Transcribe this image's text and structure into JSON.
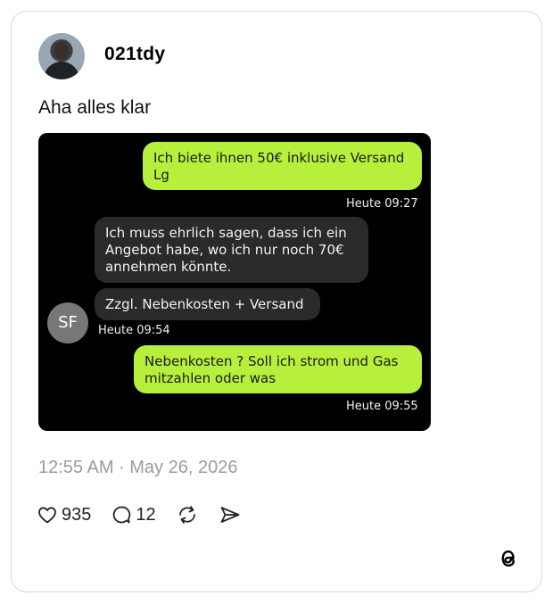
{
  "post": {
    "username": "021tdy",
    "text": "Aha alles klar",
    "timestamp": "12:55 AM · May 26, 2026"
  },
  "chat": {
    "messages": [
      {
        "direction": "out",
        "text": "Ich biete ihnen 50€ inklusive Versand Lg",
        "time": "Heute 09:27"
      },
      {
        "direction": "in",
        "text": "Ich muss ehrlich sagen, dass ich ein Angebot habe, wo ich nur noch 70€ annehmen könnte.",
        "time": ""
      },
      {
        "direction": "in",
        "text": "Zzgl. Nebenkosten + Versand",
        "time": "Heute 09:54"
      },
      {
        "direction": "out",
        "text": "Nebenkosten ? Soll ich strom und Gas mitzahlen oder was",
        "time": "Heute 09:55"
      }
    ],
    "contact_initials": "SF"
  },
  "actions": {
    "likes": "935",
    "replies": "12"
  },
  "colors": {
    "outgoing_bubble": "#b7f03c",
    "incoming_bubble": "#2a2a2a",
    "chat_background": "#000000"
  }
}
